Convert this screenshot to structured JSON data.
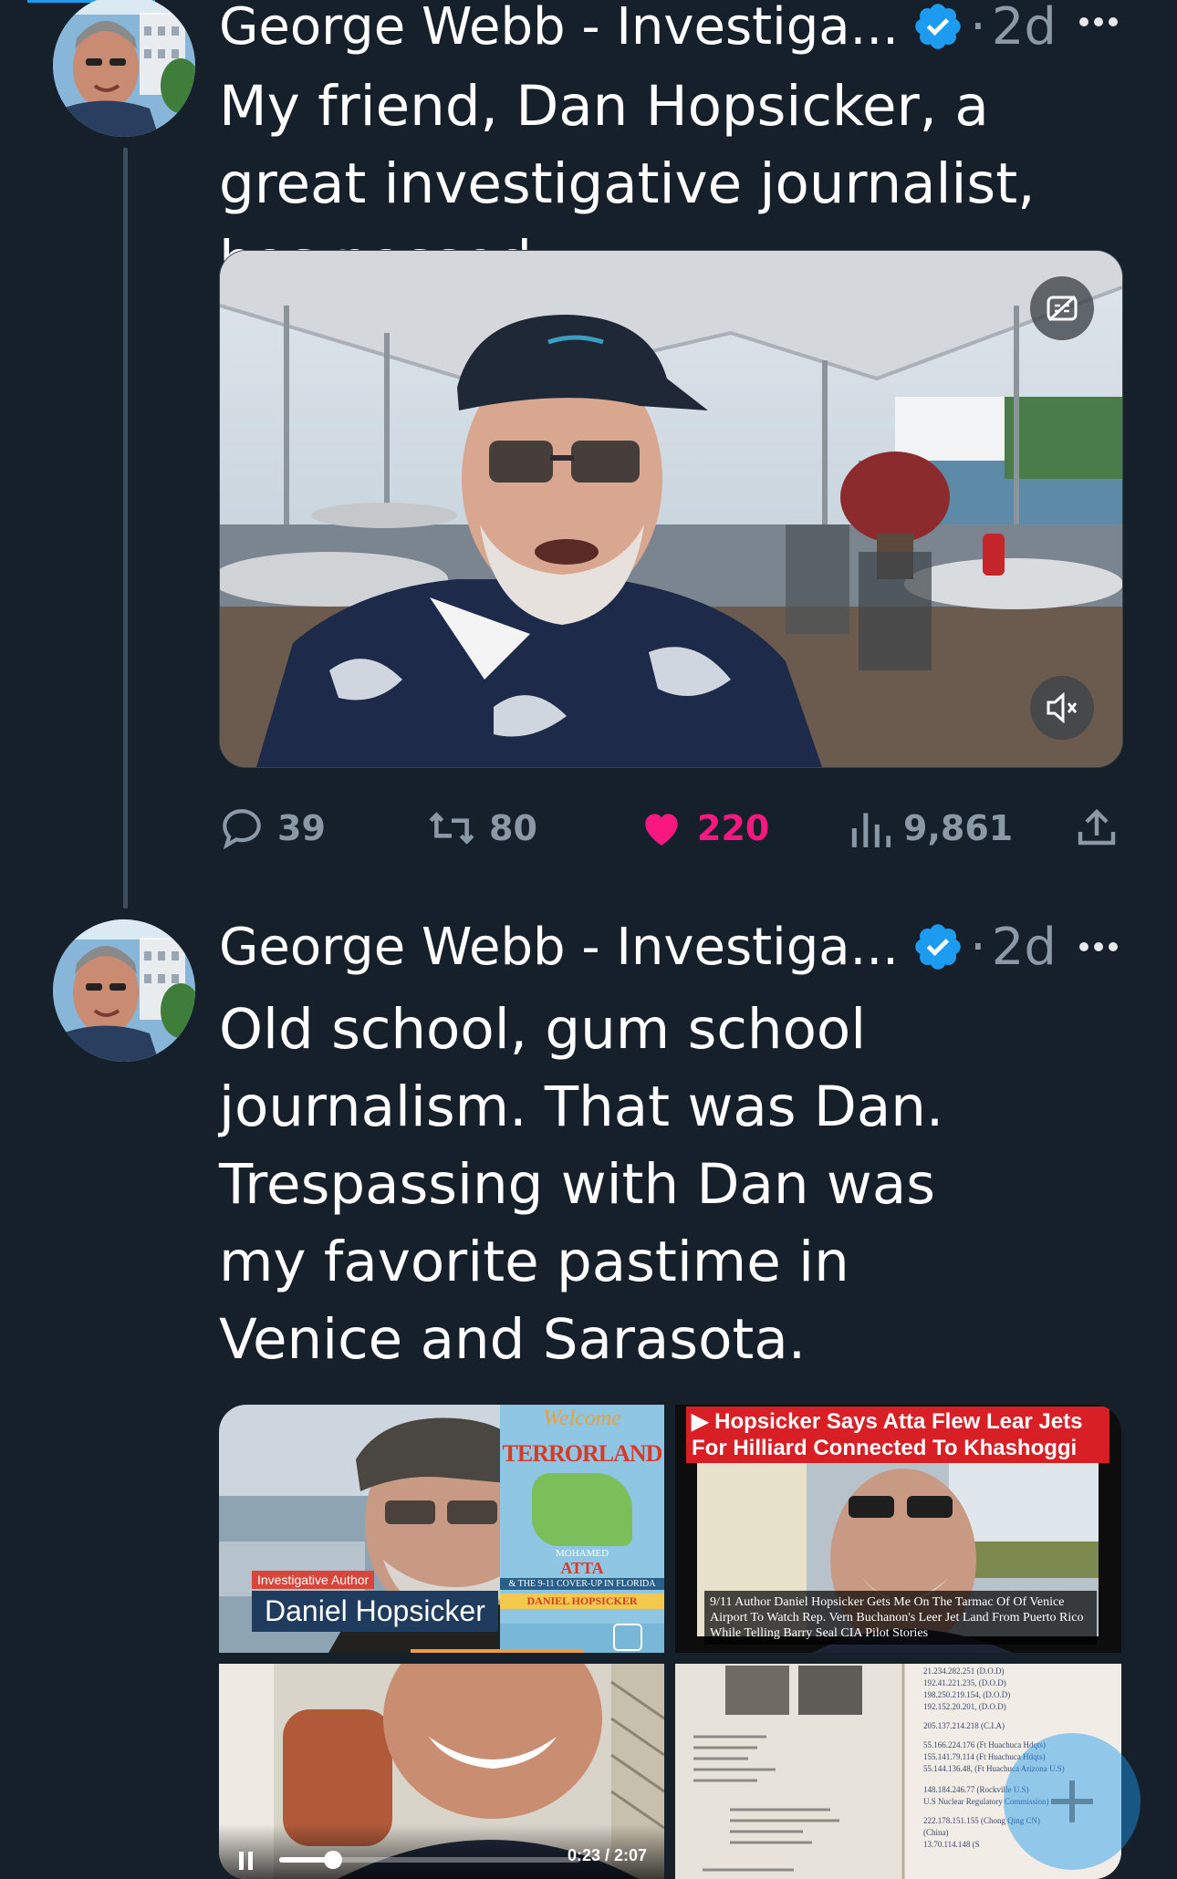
{
  "tweets": [
    {
      "author": "George Webb - Investiga...",
      "dot": "·",
      "time": "2d",
      "text": "My friend, Dan Hopsicker, a great investigative journalist, has passed.",
      "stats": {
        "replies": "39",
        "retweets": "80",
        "likes": "220",
        "views": "9,861"
      }
    },
    {
      "author": "George Webb - Investiga...",
      "dot": "·",
      "time": "2d",
      "text": "Old school, gum school journalism. That was Dan. Trespassing with Dan was my favorite pastime in Venice and Sarasota.",
      "media": [
        {
          "label_small": "Investigative Author",
          "label_name": "Daniel Hopsicker",
          "book_welcome": "Welcome",
          "book_title": "TERRORLAND",
          "book_sub1": "MOHAMED",
          "book_sub2": "ATTA",
          "book_sub3": "& THE 9-11 COVER-UP IN FLORIDA",
          "book_author": "DANIEL HOPSICKER"
        },
        {
          "headline": "▶ Hopsicker Says Atta Flew Lear Jets For Hilliard Connected To Khashoggi",
          "caption": "9/11 Author Daniel Hopsicker Gets Me On The Tarmac Of Of Venice Airport To Watch Rep. Vern Buchanon's Leer Jet Land From Puerto Rico While Telling Barry Seal CIA Pilot Stories"
        },
        {
          "time": "0:23 / 2:07",
          "progress": 0.18
        },
        {
          "doc_lines": [
            "21.234.282.251 (D.O.D)",
            "192.41.221.235, (D.O.D)",
            "198.250.219.154, (D.O.D)",
            "192.152.20.201, (D.O.D)",
            "205.137.214.218 (C.I.A)",
            "55.166.224.176 (Ft Huachuca Hdqts)",
            "155.141.79.114 (Ft Huachuca Hdqts)",
            "55.144.136.48, (Ft Huachuca Arizona U.S)",
            "148.184.246.77 (Rockville U.S)",
            "U.S Nuclear Regulatory Commission)",
            "222.178.151.155 (Chong Qing CN)",
            "(China)",
            "13.70.114.148 (S"
          ]
        }
      ]
    }
  ],
  "colors": {
    "background": "#15202b",
    "like": "#f91880",
    "verified": "#1d9bf0",
    "muted": "#8b98a5"
  }
}
